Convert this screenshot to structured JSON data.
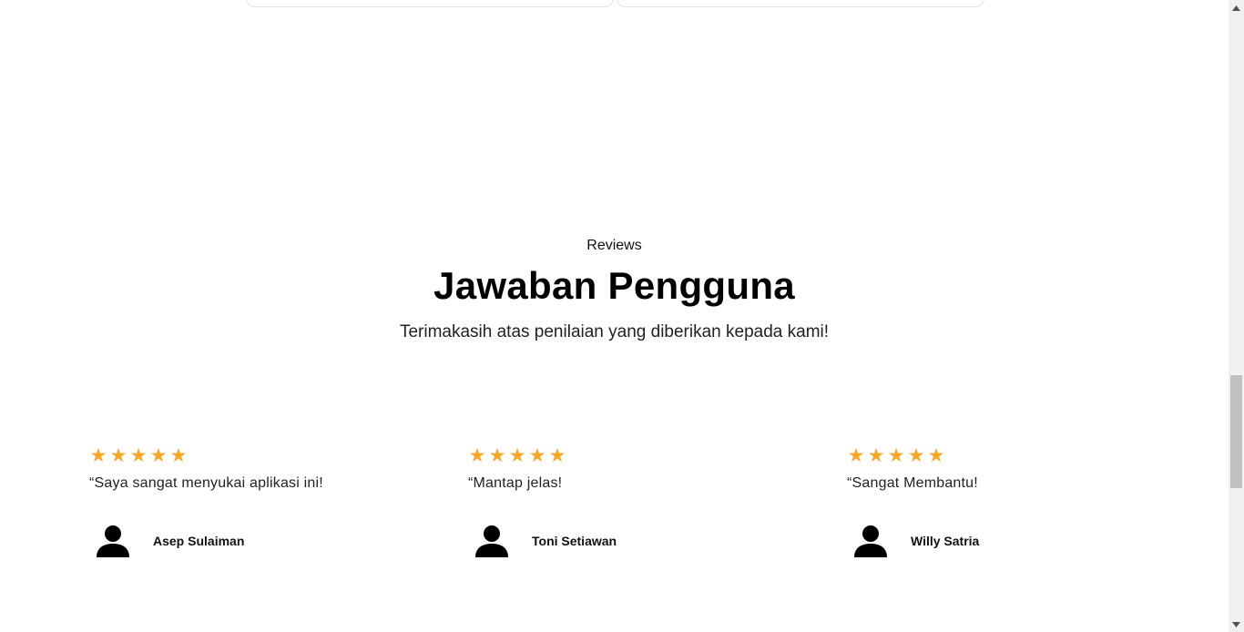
{
  "reviews_section": {
    "eyebrow": "Reviews",
    "title": "Jawaban Pengguna",
    "subtitle": "Terimakasih atas penilaian yang diberikan kepada kami!"
  },
  "reviews": [
    {
      "rating": 5,
      "quote": "“Saya sangat menyukai aplikasi ini!",
      "author": "Asep Sulaiman",
      "icon": "user-icon"
    },
    {
      "rating": 5,
      "quote": "“Mantap jelas!",
      "author": "Toni Setiawan",
      "icon": "user-icon"
    },
    {
      "rating": 5,
      "quote": "“Sangat Membantu!",
      "author": "Willy Satria",
      "icon": "user-icon"
    }
  ],
  "colors": {
    "star": "#f6a623",
    "text": "#111111",
    "background": "#ffffff"
  }
}
